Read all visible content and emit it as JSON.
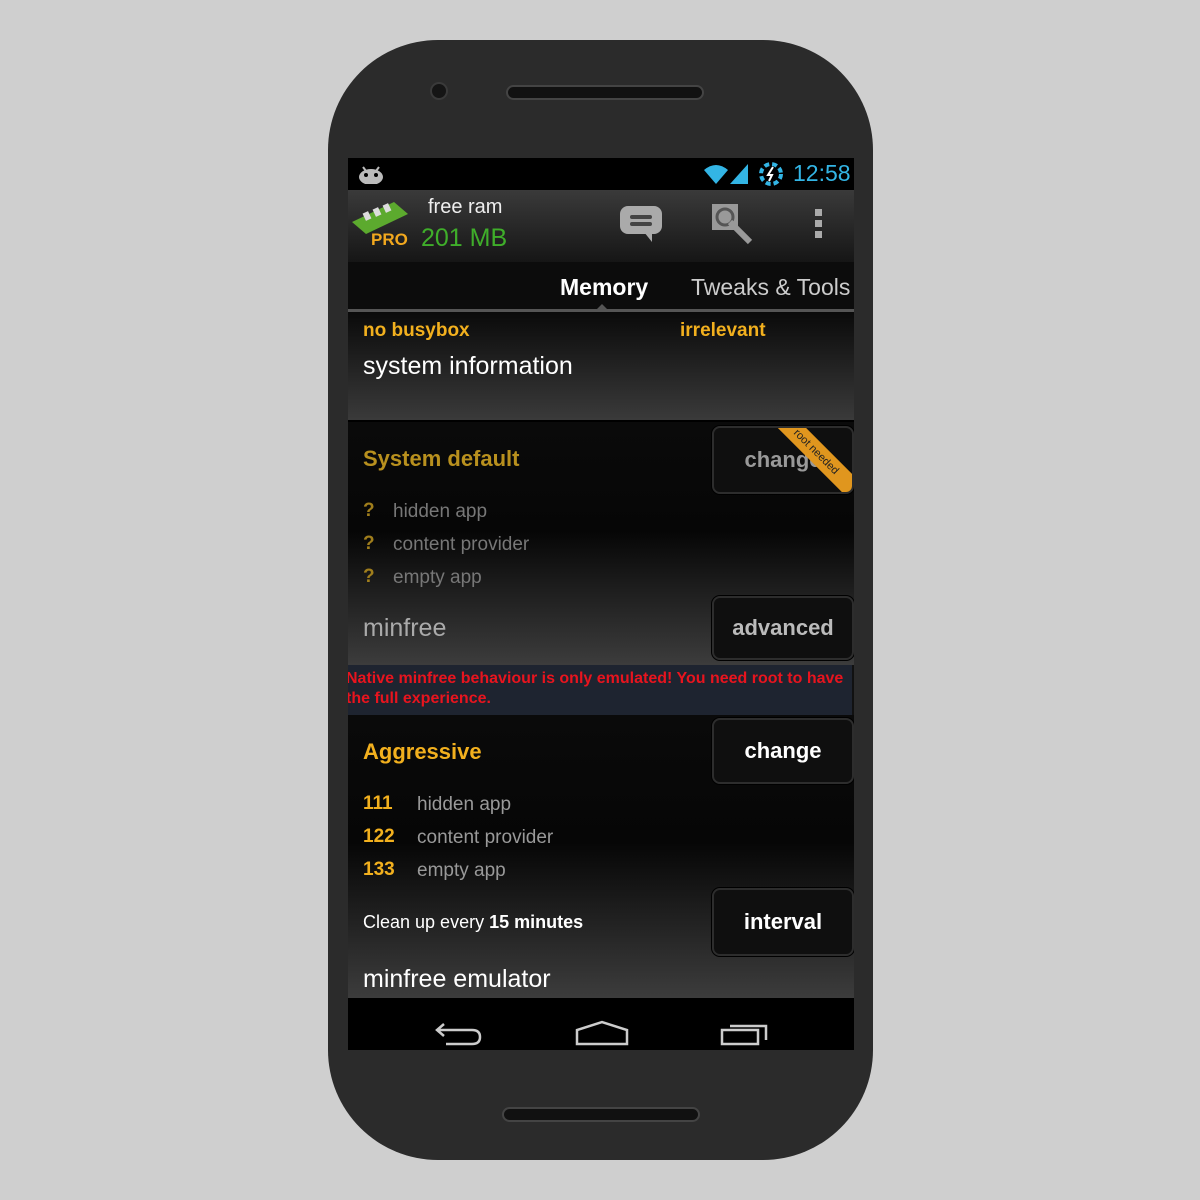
{
  "status_bar": {
    "time": "12:58",
    "time_color": "#33b5e5"
  },
  "action_bar": {
    "title": "free ram",
    "free_ram": "201 MB",
    "badge": "PRO",
    "icons": [
      "chat-icon",
      "wrench-search-icon",
      "overflow-menu-icon"
    ]
  },
  "tabs": [
    {
      "label": "Memory",
      "active": true
    },
    {
      "label": "Tweaks & Tools",
      "active": false
    }
  ],
  "sysinfo": {
    "busybox": "no busybox",
    "status": "irrelevant",
    "title": "system information"
  },
  "system_default": {
    "title": "System default",
    "change_label": "change",
    "ribbon": "root needed",
    "rows": [
      {
        "value": "?",
        "label": "hidden app"
      },
      {
        "value": "?",
        "label": "content provider"
      },
      {
        "value": "?",
        "label": "empty app"
      }
    ],
    "section": "minfree",
    "advanced_label": "advanced"
  },
  "warning": "Native minfree behaviour is only emulated! You need root to have the full experience.",
  "aggressive": {
    "title": "Aggressive",
    "change_label": "change",
    "rows": [
      {
        "value": "111",
        "label": "hidden app"
      },
      {
        "value": "122",
        "label": "content provider"
      },
      {
        "value": "133",
        "label": "empty app"
      }
    ],
    "cleanup_prefix": "Clean up every",
    "cleanup_value": "15 minutes",
    "interval_label": "interval",
    "section": "minfree emulator"
  },
  "colors": {
    "accent": "#f2b01e",
    "ram": "#3fae2a",
    "warning": "#e8141e"
  }
}
